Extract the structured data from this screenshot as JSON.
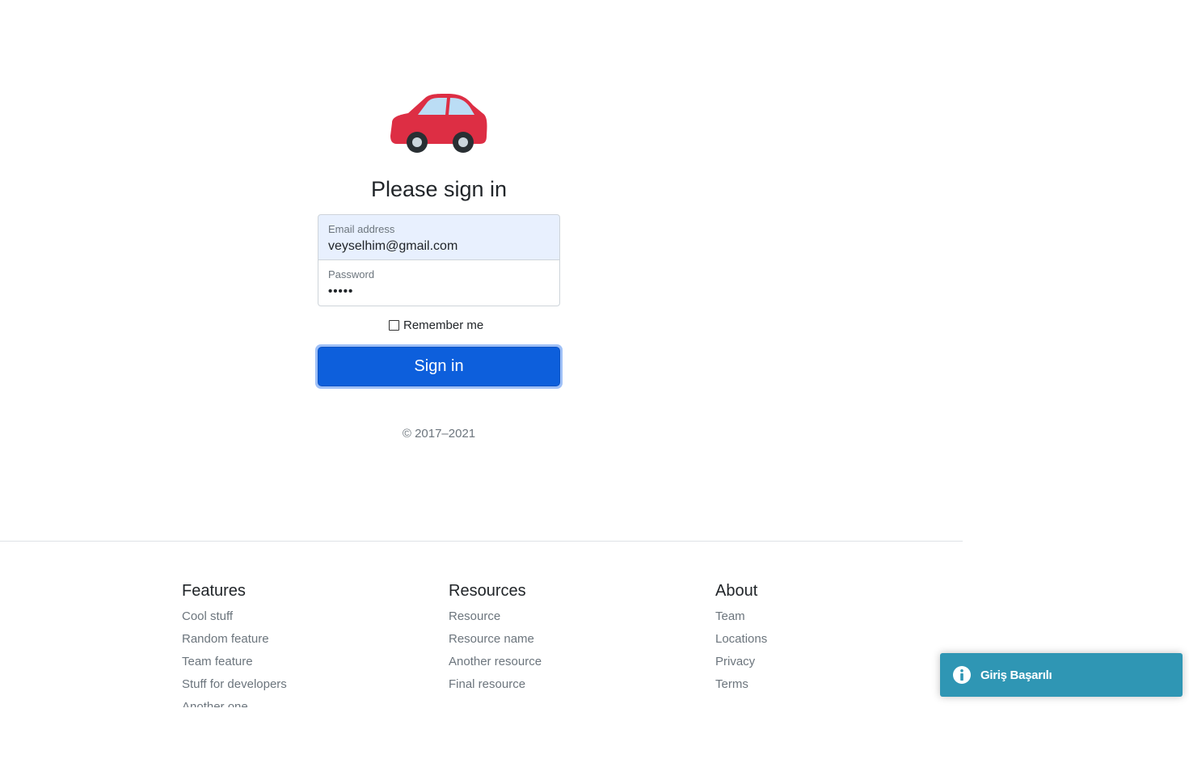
{
  "logo": {
    "icon": "car-icon",
    "color": "#dd2e44"
  },
  "signin": {
    "title": "Please sign in",
    "email": {
      "label": "Email address",
      "value": "veyselhim@gmail.com"
    },
    "password": {
      "label": "Password",
      "value": "•••••"
    },
    "remember_label": "Remember me",
    "remember_checked": false,
    "button_label": "Sign in",
    "button_color": "#0d5fdc"
  },
  "copyright": "© 2017–2021",
  "footer": {
    "columns": [
      {
        "title": "Features",
        "links": [
          "Cool stuff",
          "Random feature",
          "Team feature",
          "Stuff for developers",
          "Another one"
        ]
      },
      {
        "title": "Resources",
        "links": [
          "Resource",
          "Resource name",
          "Another resource",
          "Final resource"
        ]
      },
      {
        "title": "About",
        "links": [
          "Team",
          "Locations",
          "Privacy",
          "Terms"
        ]
      }
    ]
  },
  "toast": {
    "icon": "info-icon",
    "message": "Giriş Başarılı",
    "color": "#2f96b4"
  }
}
